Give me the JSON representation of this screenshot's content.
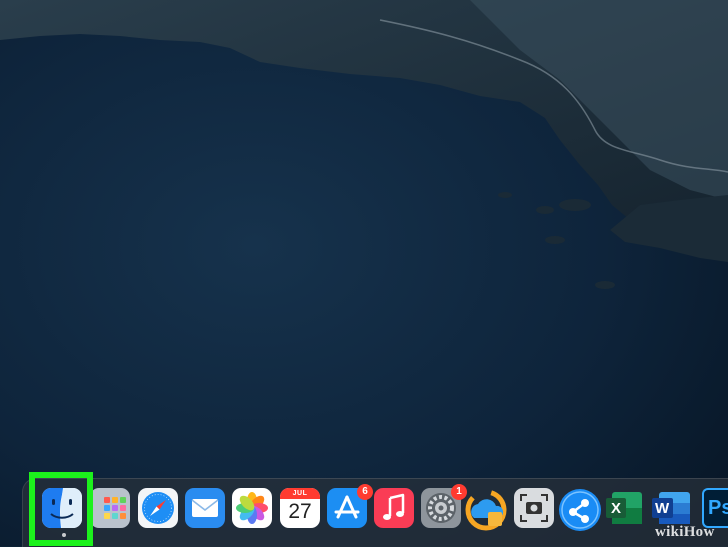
{
  "screen": {
    "type": "macOS desktop",
    "wallpaper": "coastal cliffs and ocean at dusk",
    "colors": {
      "ocean": "#0d2236",
      "land": "#1e303c",
      "highlight": "#1cf21c"
    }
  },
  "dock": {
    "apps": [
      {
        "name": "Finder",
        "icon": "finder-icon",
        "running": true,
        "highlighted": true
      },
      {
        "name": "Launchpad",
        "icon": "launchpad-icon"
      },
      {
        "name": "Safari",
        "icon": "safari-icon"
      },
      {
        "name": "Mail",
        "icon": "mail-icon"
      },
      {
        "name": "Photos",
        "icon": "photos-icon"
      },
      {
        "name": "Calendar",
        "icon": "calendar-icon",
        "month": "JUL",
        "day": "27"
      },
      {
        "name": "App Store",
        "icon": "app-store-icon",
        "badge": "6"
      },
      {
        "name": "Music",
        "icon": "music-icon"
      },
      {
        "name": "System Preferences",
        "icon": "gear-icon",
        "badge": "1"
      },
      {
        "name": "Cloud app",
        "icon": "cloud-app-icon"
      },
      {
        "name": "Screenshot",
        "icon": "screenshot-icon"
      },
      {
        "name": "SHAREit",
        "icon": "shareit-icon"
      },
      {
        "name": "Microsoft Excel",
        "icon": "excel-icon",
        "letter": "X"
      },
      {
        "name": "Microsoft Word",
        "icon": "word-icon",
        "letter": "W"
      },
      {
        "name": "Adobe Photoshop",
        "icon": "photoshop-icon",
        "letter": "Ps"
      }
    ]
  },
  "watermark": "wikiHow"
}
